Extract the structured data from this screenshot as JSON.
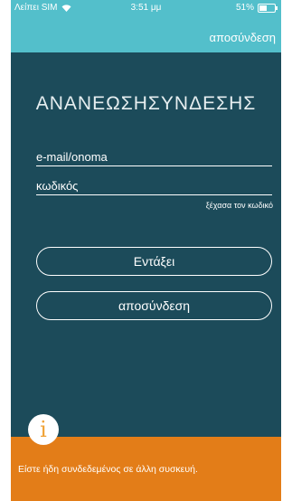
{
  "status_bar": {
    "carrier": "Λείπει SIM",
    "time": "3:51 μμ",
    "battery": "51%",
    "battery_level": 0.51
  },
  "header": {
    "logout_label": "αποσύνδεση"
  },
  "form": {
    "title": "ΑΝΑΝΕΩΣΗΣΥΝΔΕΣΗΣ",
    "email_placeholder": "e-mail/onoma",
    "password_placeholder": "κωδικός",
    "forgot_label": "ξέχασα τον κωδικό",
    "ok_button": "Εντάξει",
    "logout_button": "αποσύνδεση"
  },
  "notice": {
    "icon": "info-icon",
    "text": "Είστε ήδη συνδεδεμένος σε άλλη συσκευή."
  },
  "colors": {
    "header": "#53bfcb",
    "background": "#1c4b5a",
    "notice": "#e37d18"
  }
}
